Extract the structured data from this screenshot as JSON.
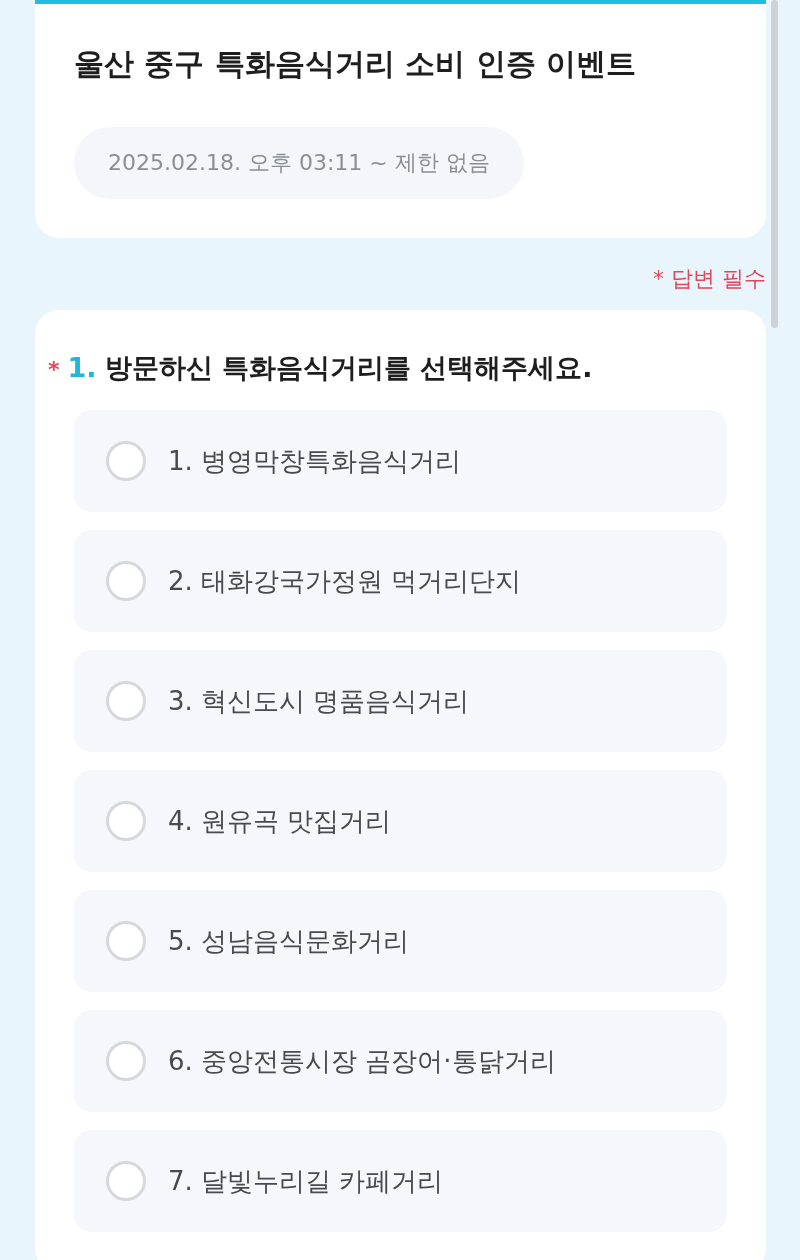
{
  "event": {
    "title": "울산 중구 특화음식거리 소비 인증 이벤트",
    "period": "2025.02.18. 오후 03:11 ~ 제한 없음"
  },
  "required_note": "* 답변 필수",
  "question": {
    "required_mark": "*",
    "number": "1.",
    "text": "방문하신 특화음식거리를 선택해주세요.",
    "options": [
      {
        "label": "1. 병영막창특화음식거리",
        "selected": false
      },
      {
        "label": "2. 태화강국가정원 먹거리단지",
        "selected": false
      },
      {
        "label": "3. 혁신도시 명품음식거리",
        "selected": false
      },
      {
        "label": "4. 원유곡 맛집거리",
        "selected": false
      },
      {
        "label": "5. 성남음식문화거리",
        "selected": false
      },
      {
        "label": "6. 중앙전통시장 곰장어·통닭거리",
        "selected": false
      },
      {
        "label": "7. 달빛누리길 카페거리",
        "selected": false
      }
    ]
  }
}
